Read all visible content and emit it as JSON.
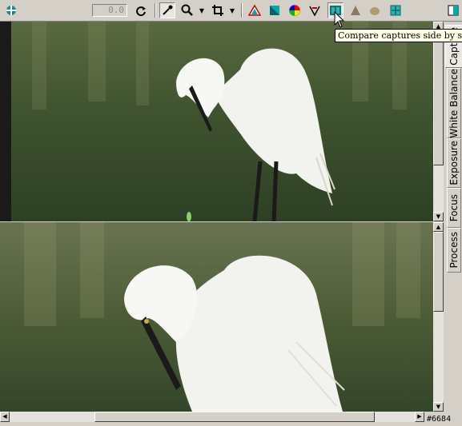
{
  "toolbar": {
    "rotation_value": "0.0",
    "icons": [
      "app-menu-icon",
      "rotate-icon",
      "eyedropper-icon",
      "zoom-icon",
      "crop-icon",
      "highlight-warning-icon",
      "shadow-warning-icon",
      "color-wheel-icon",
      "tone-curve-icon",
      "side-by-side-icon",
      "triangle-icon",
      "hand-icon",
      "fit-icon",
      "panel-toggle-icon"
    ]
  },
  "tooltip": {
    "text": "Compare captures side by side"
  },
  "side_tabs": [
    {
      "label": "Capture",
      "active": true
    },
    {
      "label": "White Balance",
      "active": false
    },
    {
      "label": "Exposure",
      "active": false
    },
    {
      "label": "Focus",
      "active": false
    },
    {
      "label": "Process",
      "active": false
    }
  ],
  "status": {
    "code": "#6684"
  },
  "colors": {
    "chrome": "#d4d0c8",
    "accent": "#008080",
    "tooltip_bg": "#ffffe1"
  }
}
